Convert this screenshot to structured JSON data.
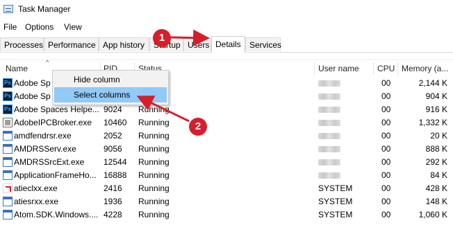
{
  "window": {
    "title": "Task Manager"
  },
  "menu": [
    "File",
    "Options",
    "View"
  ],
  "tabs": [
    "Processes",
    "Performance",
    "App history",
    "Startup",
    "Users",
    "Details",
    "Services"
  ],
  "active_tab": "Details",
  "columns": {
    "name": "Name",
    "pid": "PID",
    "status": "Status",
    "user": "User name",
    "cpu": "CPU",
    "memory": "Memory (a..."
  },
  "context_menu": {
    "items": [
      "Hide column",
      "Select columns"
    ],
    "highlighted": "Select columns"
  },
  "annotations": {
    "badge1": "1",
    "badge2": "2",
    "color": "#d61f2c"
  },
  "rows": [
    {
      "name": "Adobe Sp",
      "pid": "",
      "status": "",
      "user": "",
      "cpu": "00",
      "memory": "2,144 K",
      "icon": "adobe-icon"
    },
    {
      "name": "Adobe Sp",
      "pid": "",
      "status": "",
      "user": "",
      "cpu": "00",
      "memory": "904 K",
      "icon": "adobe-icon"
    },
    {
      "name": "Adobe Spaces Helpe...",
      "pid": "9024",
      "status": "Running",
      "user": "",
      "cpu": "00",
      "memory": "916 K",
      "icon": "adobe-icon"
    },
    {
      "name": "AdobeIPCBroker.exe",
      "pid": "10460",
      "status": "Running",
      "user": "",
      "cpu": "00",
      "memory": "1,332 K",
      "icon": "broker-icon"
    },
    {
      "name": "amdfendrsr.exe",
      "pid": "2052",
      "status": "Running",
      "user": "",
      "cpu": "00",
      "memory": "20 K",
      "icon": "window-icon"
    },
    {
      "name": "AMDRSServ.exe",
      "pid": "9056",
      "status": "Running",
      "user": "",
      "cpu": "00",
      "memory": "888 K",
      "icon": "window-icon"
    },
    {
      "name": "AMDRSSrcExt.exe",
      "pid": "12544",
      "status": "Running",
      "user": "",
      "cpu": "00",
      "memory": "292 K",
      "icon": "window-icon"
    },
    {
      "name": "ApplicationFrameHo...",
      "pid": "16888",
      "status": "Running",
      "user": "",
      "cpu": "00",
      "memory": "84 K",
      "icon": "window-icon"
    },
    {
      "name": "atieclxx.exe",
      "pid": "2416",
      "status": "Running",
      "user": "SYSTEM",
      "cpu": "00",
      "memory": "428 K",
      "icon": "amd-icon"
    },
    {
      "name": "atiesrxx.exe",
      "pid": "1936",
      "status": "Running",
      "user": "SYSTEM",
      "cpu": "00",
      "memory": "148 K",
      "icon": "window-icon"
    },
    {
      "name": "Atom.SDK.Windows....",
      "pid": "4228",
      "status": "Running",
      "user": "SYSTEM",
      "cpu": "00",
      "memory": "1,060 K",
      "icon": "window-icon"
    }
  ]
}
